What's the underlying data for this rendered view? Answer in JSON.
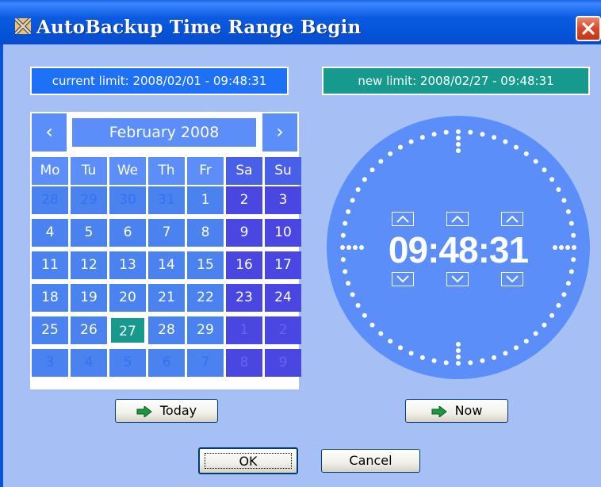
{
  "window": {
    "title": "AutoBackup Time Range Begin"
  },
  "limits": {
    "current": "current limit: 2008/02/01 - 09:48:31",
    "new": "new limit: 2008/02/27 - 09:48:31"
  },
  "calendar": {
    "prev_glyph": "‹",
    "next_glyph": "›",
    "month_label": "February 2008",
    "weekdays": [
      "Mo",
      "Tu",
      "We",
      "Th",
      "Fr",
      "Sa",
      "Su"
    ],
    "weeks": [
      [
        "28",
        "29",
        "30",
        "31",
        "1",
        "2",
        "3"
      ],
      [
        "4",
        "5",
        "6",
        "7",
        "8",
        "9",
        "10"
      ],
      [
        "11",
        "12",
        "13",
        "14",
        "15",
        "16",
        "17"
      ],
      [
        "18",
        "19",
        "20",
        "21",
        "22",
        "23",
        "24"
      ],
      [
        "25",
        "26",
        "27",
        "28",
        "29",
        "1",
        "2"
      ],
      [
        "3",
        "4",
        "5",
        "6",
        "7",
        "8",
        "9"
      ]
    ],
    "selected_day": "27"
  },
  "clock": {
    "hours": "09",
    "minutes": "48",
    "seconds": "31",
    "separator": ":"
  },
  "buttons": {
    "today": "Today",
    "now": "Now",
    "ok": "OK",
    "cancel": "Cancel"
  },
  "colors": {
    "current_limit_bg": "#1e70f6",
    "new_limit_bg": "#169a8e",
    "selected_day_bg": "#169a8e",
    "dialog_bg": "#a6c0f6"
  },
  "icons": {
    "app": "autobackup-icon",
    "close": "close-icon",
    "go": "green-arrow-icon"
  }
}
